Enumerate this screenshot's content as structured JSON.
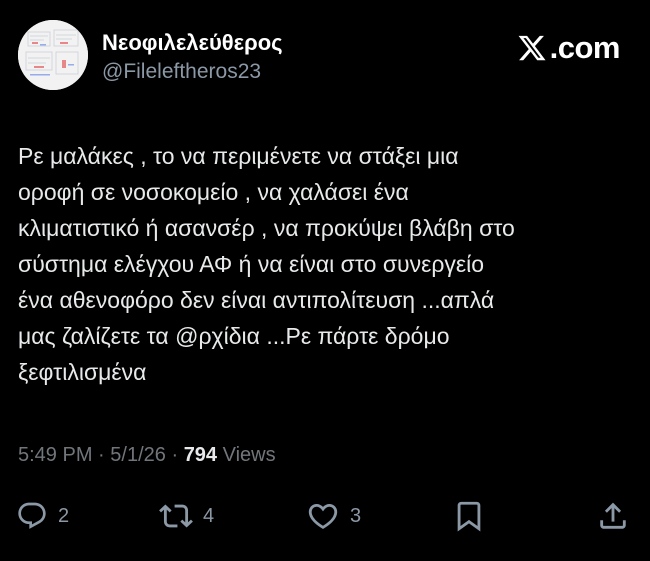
{
  "tweet": {
    "display_name": "Νεοφιλελεύθερος",
    "handle": "@Fileleftheros23",
    "brand": {
      "logo_icon": "x-logo-icon",
      "domain_text": ".com"
    },
    "text_lines": [
      "Ρε μαλάκες , το να περιμένετε να στάξει μια",
      "οροφή σε νοσοκομείο , να χαλάσει ένα",
      "κλιματιστικό ή ασανσέρ , να προκύψει βλάβη στο",
      "σύστημα ελέγχου ΑΦ ή να είναι στο συνεργείο",
      "ένα αθενοφόρο δεν είναι αντιπολίτευση ...απλά",
      "μας ζαλίζετε τα @ρχίδια ...Ρε πάρτε δρόμο",
      "ξεφτιλισμένα"
    ],
    "meta": {
      "time": "5:49 PM",
      "separator": "·",
      "date": "5/1/26",
      "views_count": "794",
      "views_label": "Views"
    },
    "actions": {
      "replies": "2",
      "reposts": "4",
      "likes": "3"
    }
  },
  "icons": {
    "reply": "reply-bubble-icon",
    "repost": "repost-arrows-icon",
    "like": "heart-icon",
    "bookmark": "bookmark-icon",
    "share": "share-upload-icon"
  },
  "colors": {
    "background": "#000000",
    "primary_text": "#e7e9ea",
    "secondary_text": "#71767b",
    "icon_gray": "#8b98a5"
  }
}
